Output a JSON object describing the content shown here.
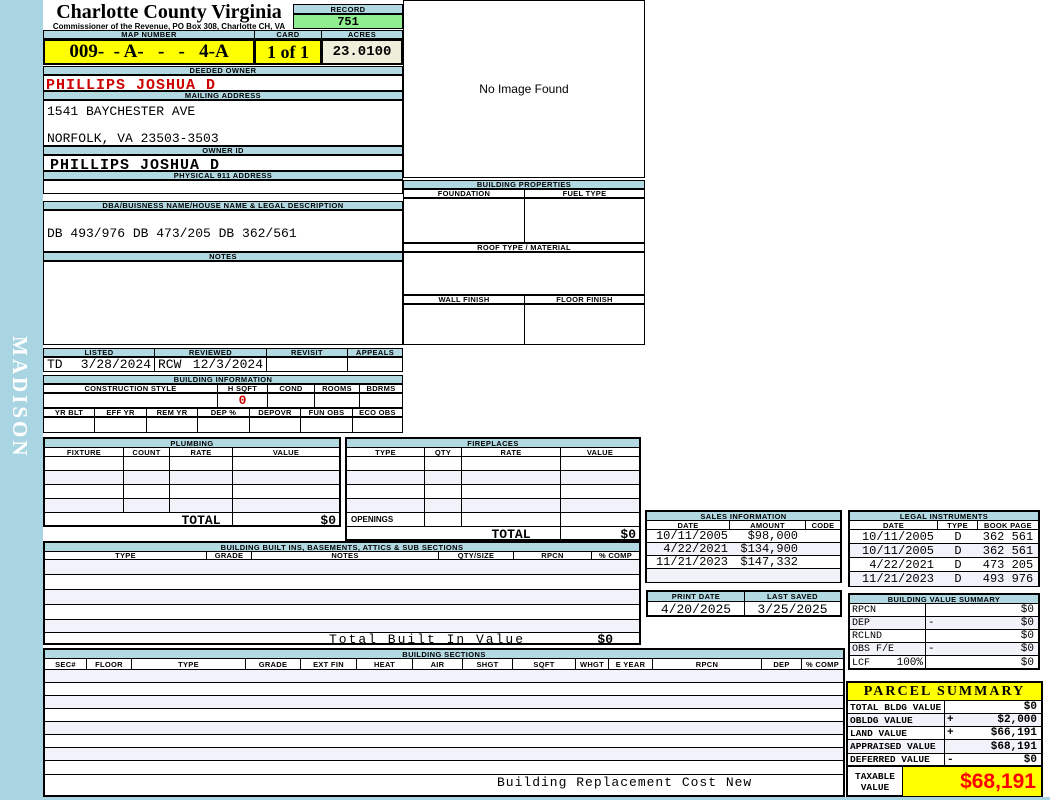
{
  "colors": {
    "header_bar": "#b2d8e2",
    "sidebar": "#a9d5e2",
    "record_green": "#90ee90",
    "highlight_yellow": "#ffff00",
    "acres_cream": "#eeeedb",
    "owner_red": "#cc0000",
    "taxable_red": "#ff0000",
    "alt_row": "#f2f2fa"
  },
  "sidebar": {
    "watermark": "MADISON"
  },
  "header": {
    "title": "Charlotte County Virginia",
    "subtitle": "Commissioner of the Revenue, PO Box 308, Charlotte CH, VA",
    "record_label": "RECORD",
    "record_value": "751",
    "map_number_label": "MAP NUMBER",
    "map_number": "009-  - A-   -   -   4-A",
    "card_label": "CARD",
    "card_value": "1 of 1",
    "acres_label": "ACRES",
    "acres_value": "23.0100"
  },
  "owner": {
    "deeded_owner_label": "DEEDED OWNER",
    "deeded_owner": "PHILLIPS JOSHUA D",
    "mailing_address_label": "MAILING ADDRESS",
    "mailing_line1": "1541 BAYCHESTER AVE",
    "mailing_line2": "NORFOLK, VA 23503-3503",
    "owner_id_label": "OWNER ID",
    "owner_id": "PHILLIPS JOSHUA D",
    "physical_address_label": "PHYSICAL 911 ADDRESS",
    "physical_address": ""
  },
  "legal_desc": {
    "dba_label": "DBA/BUISNESS NAME/HOUSE NAME & LEGAL DESCRIPTION",
    "description": "DB 493/976 DB 473/205 DB 362/561",
    "notes_label": "NOTES",
    "notes": ""
  },
  "review": {
    "listed_label": "LISTED",
    "listed_by": "TD",
    "listed_date": "3/28/2024",
    "reviewed_label": "REVIEWED",
    "reviewed_by": "RCW",
    "reviewed_date": "12/3/2024",
    "revisit_label": "REVISIT",
    "revisit": "",
    "appeals_label": "APPEALS",
    "appeals": ""
  },
  "image_panel": {
    "no_image_text": "No Image Found"
  },
  "building_properties": {
    "title": "BUILDING PROPERTIES",
    "foundation_label": "FOUNDATION",
    "fuel_type_label": "FUEL TYPE",
    "foundation": "",
    "fuel_type": "",
    "roof_label": "ROOF TYPE / MATERIAL",
    "roof": "",
    "wall_label": "WALL FINISH",
    "floor_label": "FLOOR FINISH",
    "wall": "",
    "floor": ""
  },
  "building_info": {
    "title": "BUILDING INFORMATION",
    "construction_style_label": "CONSTRUCTION STYLE",
    "h_sqft_label": "H SQFT",
    "cond_label": "COND",
    "rooms_label": "ROOMS",
    "bdrms_label": "BDRMS",
    "construction_style": "",
    "h_sqft": "0",
    "cond": "",
    "rooms": "",
    "bdrms": "",
    "row2_labels": [
      "YR BLT",
      "EFF YR",
      "REM YR",
      "DEP %",
      "DEPOVR",
      "FUN OBS",
      "ECO OBS"
    ],
    "row2_values": [
      "",
      "",
      "",
      "",
      "",
      "",
      ""
    ]
  },
  "plumbing": {
    "title": "PLUMBING",
    "columns": [
      "FIXTURE",
      "COUNT",
      "RATE",
      "VALUE"
    ],
    "total_label": "TOTAL",
    "total_value": "$0"
  },
  "fireplaces": {
    "title": "FIREPLACES",
    "columns": [
      "TYPE",
      "QTY",
      "RATE",
      "VALUE"
    ],
    "openings_label": "OPENINGS",
    "total_label": "TOTAL",
    "total_value": "$0"
  },
  "built_ins": {
    "title": "BUILDING BUILT INS, BASEMENTS, ATTICS & SUB SECTIONS",
    "columns": [
      "TYPE",
      "GRADE",
      "NOTES",
      "QTY/SIZE",
      "RPCN",
      "% COMP"
    ],
    "total_label": "Total Built In Value",
    "total_value": "$0"
  },
  "building_sections": {
    "title": "BUILDING SECTIONS",
    "columns": [
      "SEC#",
      "FLOOR",
      "TYPE",
      "GRADE",
      "EXT FIN",
      "HEAT",
      "AIR",
      "SHGT",
      "SQFT",
      "WHGT",
      "E YEAR",
      "RPCN",
      "DEP",
      "% COMP"
    ],
    "footer": "Building Replacement Cost New"
  },
  "sales": {
    "title": "SALES INFORMATION",
    "columns": [
      "DATE",
      "AMOUNT",
      "CODE"
    ],
    "rows": [
      {
        "date": "10/11/2005",
        "amount": "$98,000",
        "code": ""
      },
      {
        "date": "4/22/2021",
        "amount": "$134,900",
        "code": ""
      },
      {
        "date": "11/21/2023",
        "amount": "$147,332",
        "code": ""
      },
      {
        "date": "",
        "amount": "",
        "code": ""
      }
    ]
  },
  "print_info": {
    "print_date_label": "PRINT DATE",
    "print_date": "4/20/2025",
    "last_saved_label": "LAST SAVED",
    "last_saved": "3/25/2025"
  },
  "legal_instruments": {
    "title": "LEGAL INSTRUMENTS",
    "columns": [
      "DATE",
      "TYPE",
      "BOOK PAGE"
    ],
    "rows": [
      {
        "date": "10/11/2005",
        "type": "D",
        "book_page": "362 561"
      },
      {
        "date": "10/11/2005",
        "type": "D",
        "book_page": "362 561"
      },
      {
        "date": "4/22/2021",
        "type": "D",
        "book_page": "473 205"
      },
      {
        "date": "11/21/2023",
        "type": "D",
        "book_page": "493 976"
      }
    ]
  },
  "value_summary": {
    "title": "BUILDING VALUE SUMMARY",
    "rows": [
      {
        "label": "RPCN",
        "extra": "",
        "op": "",
        "value": "$0"
      },
      {
        "label": "DEP",
        "extra": "",
        "op": "-",
        "value": "$0"
      },
      {
        "label": "RCLND",
        "extra": "",
        "op": "",
        "value": "$0"
      },
      {
        "label": "OBS F/E",
        "extra": "",
        "op": "-",
        "value": "$0"
      },
      {
        "label": "LCF",
        "extra": "100%",
        "op": "",
        "value": "$0"
      }
    ]
  },
  "parcel_summary": {
    "title": "PARCEL SUMMARY",
    "rows": [
      {
        "label": "TOTAL BLDG VALUE",
        "op": "",
        "value": "$0"
      },
      {
        "label": "OBLDG VALUE",
        "op": "+",
        "value": "$2,000"
      },
      {
        "label": "LAND VALUE",
        "op": "+",
        "value": "$66,191"
      },
      {
        "label": "APPRAISED VALUE",
        "op": "",
        "value": "$68,191"
      },
      {
        "label": "DEFERRED VALUE",
        "op": "-",
        "value": "$0"
      }
    ],
    "taxable_label_line1": "TAXABLE",
    "taxable_label_line2": "VALUE",
    "taxable_value": "$68,191"
  }
}
